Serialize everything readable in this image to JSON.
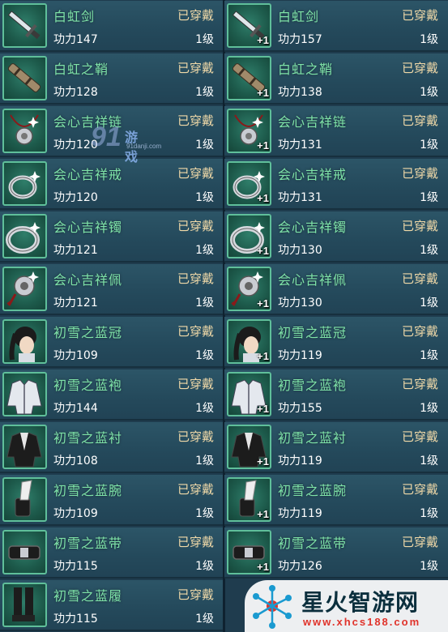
{
  "status_label": "已穿戴",
  "plus_label": "+1",
  "left_items": [
    {
      "name": "白虹剑",
      "power": "功力147",
      "level": "1级",
      "icon": "sword-icon"
    },
    {
      "name": "白虹之鞘",
      "power": "功力128",
      "level": "1级",
      "icon": "scabbard-icon"
    },
    {
      "name": "会心吉祥链",
      "power": "功力120",
      "level": "1级",
      "icon": "necklace-icon"
    },
    {
      "name": "会心吉祥戒",
      "power": "功力120",
      "level": "1级",
      "icon": "ring-icon"
    },
    {
      "name": "会心吉祥镯",
      "power": "功力121",
      "level": "1级",
      "icon": "bracelet-icon"
    },
    {
      "name": "会心吉祥佩",
      "power": "功力121",
      "level": "1级",
      "icon": "pendant-icon"
    },
    {
      "name": "初雪之蓝冠",
      "power": "功力109",
      "level": "1级",
      "icon": "crown-icon"
    },
    {
      "name": "初雪之蓝袍",
      "power": "功力144",
      "level": "1级",
      "icon": "robe-icon"
    },
    {
      "name": "初雪之蓝衬",
      "power": "功力108",
      "level": "1级",
      "icon": "shirt-icon"
    },
    {
      "name": "初雪之蓝腕",
      "power": "功力109",
      "level": "1级",
      "icon": "bracer-icon"
    },
    {
      "name": "初雪之蓝带",
      "power": "功力115",
      "level": "1级",
      "icon": "belt-icon"
    },
    {
      "name": "初雪之蓝履",
      "power": "功力115",
      "level": "1级",
      "icon": "boots-icon"
    }
  ],
  "right_items": [
    {
      "name": "白虹剑",
      "power": "功力157",
      "level": "1级",
      "icon": "sword-icon"
    },
    {
      "name": "白虹之鞘",
      "power": "功力138",
      "level": "1级",
      "icon": "scabbard-icon"
    },
    {
      "name": "会心吉祥链",
      "power": "功力131",
      "level": "1级",
      "icon": "necklace-icon"
    },
    {
      "name": "会心吉祥戒",
      "power": "功力131",
      "level": "1级",
      "icon": "ring-icon"
    },
    {
      "name": "会心吉祥镯",
      "power": "功力130",
      "level": "1级",
      "icon": "bracelet-icon"
    },
    {
      "name": "会心吉祥佩",
      "power": "功力130",
      "level": "1级",
      "icon": "pendant-icon"
    },
    {
      "name": "初雪之蓝冠",
      "power": "功力119",
      "level": "1级",
      "icon": "crown-icon"
    },
    {
      "name": "初雪之蓝袍",
      "power": "功力155",
      "level": "1级",
      "icon": "robe-icon"
    },
    {
      "name": "初雪之蓝衬",
      "power": "功力119",
      "level": "1级",
      "icon": "shirt-icon"
    },
    {
      "name": "初雪之蓝腕",
      "power": "功力119",
      "level": "1级",
      "icon": "bracer-icon"
    },
    {
      "name": "初雪之蓝带",
      "power": "功力126",
      "level": "1级",
      "icon": "belt-icon"
    }
  ],
  "watermark": {
    "big": "91",
    "name": "游戏",
    "url": "91danji.com"
  },
  "brand": {
    "title": "星火智游网",
    "url": "www.xhcs188.com"
  },
  "colors": {
    "name": "#7fe3a8",
    "status": "#f0d9a8",
    "panel": "#24495b",
    "icon_border": "#5fbf9a"
  }
}
